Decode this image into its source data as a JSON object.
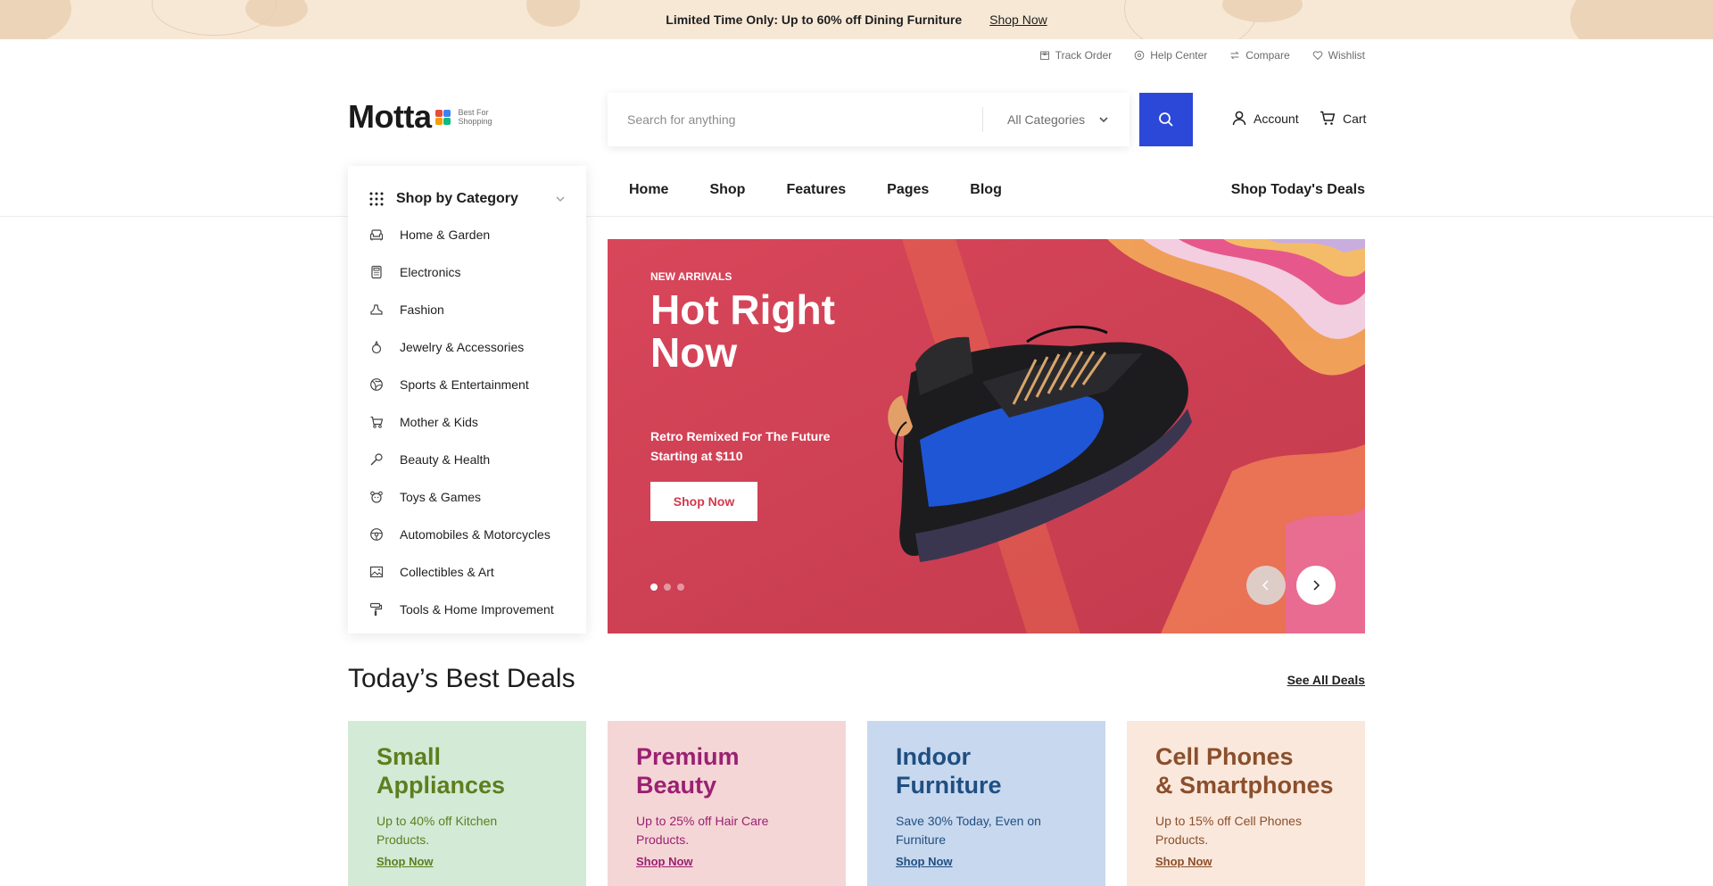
{
  "promo": {
    "text": "Limited Time Only: Up to 60% off Dining Furniture",
    "link": "Shop Now"
  },
  "top_links": [
    "Track Order",
    "Help Center",
    "Compare",
    "Wishlist"
  ],
  "logo": {
    "word": "Motta",
    "tagline_1": "Best For",
    "tagline_2": "Shopping",
    "mark_colors": [
      "#e74c3c",
      "#3b82f6",
      "#f59e0b",
      "#10b981"
    ]
  },
  "search": {
    "placeholder": "Search for anything",
    "category": "All Categories"
  },
  "header": {
    "account": "Account",
    "cart": "Cart"
  },
  "nav": {
    "items": [
      "Home",
      "Shop",
      "Features",
      "Pages",
      "Blog"
    ],
    "deals": "Shop Today's Deals"
  },
  "categories": {
    "title": "Shop by Category",
    "items": [
      {
        "label": "Home & Garden",
        "icon": "sofa-icon"
      },
      {
        "label": "Electronics",
        "icon": "calculator-icon"
      },
      {
        "label": "Fashion",
        "icon": "shoe-icon"
      },
      {
        "label": "Jewelry & Accessories",
        "icon": "ring-icon"
      },
      {
        "label": "Sports & Entertainment",
        "icon": "ball-icon"
      },
      {
        "label": "Mother & Kids",
        "icon": "stroller-icon"
      },
      {
        "label": "Beauty & Health",
        "icon": "brush-icon"
      },
      {
        "label": "Toys & Games",
        "icon": "teddy-bear-icon"
      },
      {
        "label": "Automobiles & Motorcycles",
        "icon": "steering-wheel-icon"
      },
      {
        "label": "Collectibles & Art",
        "icon": "picture-icon"
      },
      {
        "label": "Tools & Home Improvement",
        "icon": "paint-roller-icon"
      }
    ]
  },
  "hero": {
    "eyebrow": "NEW ARRIVALS",
    "headline": "Hot Right Now",
    "subtitle_1": "Retro Remixed For The Future",
    "subtitle_2": "Starting at $110",
    "button": "Shop Now",
    "slides": 3,
    "active_slide": 1
  },
  "best_deals": {
    "title": "Today’s Best Deals",
    "see_all": "See All Deals",
    "cards": [
      {
        "title_1": "Small",
        "title_2": "Appliances",
        "desc": "Up to 40% off Kitchen Products.",
        "link": "Shop Now",
        "bg": "#d3ead6",
        "color": "#5e7e1f"
      },
      {
        "title_1": "Premium",
        "title_2": "Beauty",
        "desc": "Up to 25% off Hair Care Products.",
        "link": "Shop Now",
        "bg": "#f5d6d6",
        "color": "#9b2072"
      },
      {
        "title_1": "Indoor",
        "title_2": "Furniture",
        "desc": "Save 30% Today, Even on Furniture",
        "link": "Shop Now",
        "bg": "#c8d8ee",
        "color": "#1f4f82"
      },
      {
        "title_1": "Cell Phones",
        "title_2": "& Smartphones",
        "desc": "Up to 15% off Cell Phones Products.",
        "link": "Shop Now",
        "bg": "#fbe8dc",
        "color": "#8a4f2c"
      }
    ]
  },
  "colors": {
    "accent": "#2c48d8",
    "hero_bg": "#cc3f55",
    "promo_bg": "#f7e8d6"
  }
}
